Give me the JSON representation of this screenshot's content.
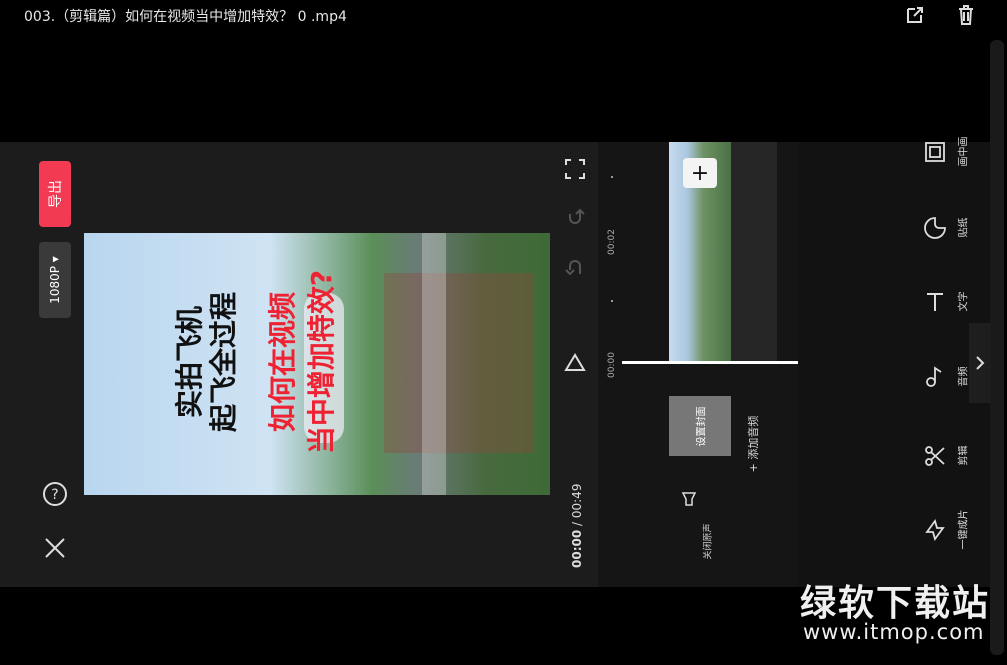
{
  "window": {
    "title": "003.（剪辑篇）如何在视频当中增加特效？ 0 .mp4"
  },
  "editor": {
    "export_label": "导出",
    "resolution_label": "1080P ▾",
    "time_current": "00:00",
    "time_separator": " / ",
    "time_total": "00:49",
    "ruler_t0": "00:00",
    "ruler_t1": "00:02",
    "add_music_label": "+ 添加音频",
    "mute_label": "关闭原声",
    "cover_label": "设置封面"
  },
  "video": {
    "caption_line1": "实拍飞机",
    "caption_line2": "起飞全过程",
    "caption_line3": "如何在视频",
    "caption_line4": "当中增加特效?",
    "caption_color_1": "#111111",
    "caption_color_2": "#ee2233"
  },
  "tools": [
    {
      "label": "一键成片",
      "icon": "bolt-icon"
    },
    {
      "label": "剪辑",
      "icon": "scissors-icon"
    },
    {
      "label": "音频",
      "icon": "music-note-icon"
    },
    {
      "label": "文字",
      "icon": "text-icon"
    },
    {
      "label": "贴纸",
      "icon": "sticker-icon"
    },
    {
      "label": "画中画",
      "icon": "picture-in-picture-icon"
    }
  ],
  "watermark": {
    "line1": "绿软下载站",
    "line2": "www.itmop.com"
  },
  "colors": {
    "accent": "#f23b53",
    "background": "#000000",
    "panel": "#1c1c1c"
  }
}
